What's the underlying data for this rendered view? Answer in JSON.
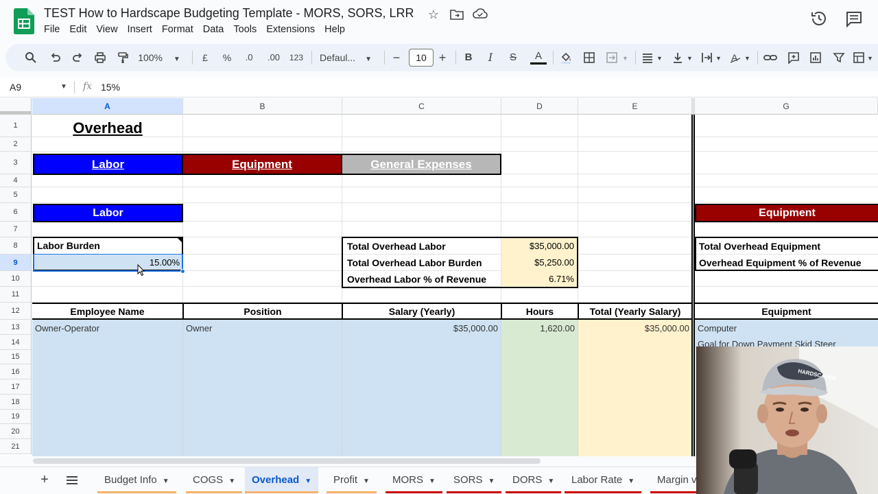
{
  "app": {
    "title": "TEST How to Hardscape Budgeting Template - MORS, SORS, LRR",
    "menu": [
      "File",
      "Edit",
      "View",
      "Insert",
      "Format",
      "Data",
      "Tools",
      "Extensions",
      "Help"
    ]
  },
  "toolbar": {
    "zoom": "100%",
    "currency": "£",
    "percent": "%",
    "dec_less": ".0",
    "dec_more": ".00",
    "format_num": "123",
    "font": "Defaul...",
    "font_size": "10",
    "minus": "−",
    "plus": "+",
    "bold": "B",
    "italic": "I",
    "strike": "S",
    "textcolor": "A"
  },
  "formula_bar": {
    "name_box": "A9",
    "fx": "fx",
    "value": "15%"
  },
  "grid": {
    "columns": [
      "A",
      "B",
      "C",
      "D",
      "E",
      "G"
    ],
    "rows": [
      "1",
      "2",
      "3",
      "4",
      "5",
      "6",
      "7",
      "8",
      "9",
      "10",
      "11",
      "12",
      "13",
      "14",
      "15",
      "16",
      "17",
      "18",
      "19",
      "20",
      "21"
    ],
    "a1": "Overhead",
    "nav_labor": "Labor",
    "nav_equipment": "Equipment",
    "nav_general": "General Expenses",
    "labor_header": "Labor",
    "equipment_header": "Equipment",
    "labor_burden_label": "Labor Burden",
    "labor_burden_value": "15.00%",
    "summary_labels": [
      "Total Overhead Labor",
      "Total Overhead Labor Burden",
      "Overhead Labor % of Revenue"
    ],
    "summary_values": [
      "$35,000.00",
      "$5,250.00",
      "6.71%"
    ],
    "equip_summary_labels": [
      "Total Overhead Equipment",
      "Overhead Equipment % of Revenue"
    ],
    "table_headers": [
      "Employee Name",
      "Position",
      "Salary (Yearly)",
      "Hours",
      "Total (Yearly Salary)",
      "Equipment"
    ],
    "row13": [
      "Owner-Operator",
      "Owner",
      "$35,000.00",
      "1,620.00",
      "$35,000.00",
      "Computer"
    ],
    "g14": "Goal for Down Payment Skid Steer"
  },
  "tabs": [
    {
      "label": "Budget Info",
      "color": "#f6b26b"
    },
    {
      "label": "COGS",
      "color": "#f6b26b"
    },
    {
      "label": "Overhead",
      "color": "#f6b26b"
    },
    {
      "label": "Profit",
      "color": "#f6b26b"
    },
    {
      "label": "MORS",
      "color": "#cc0000"
    },
    {
      "label": "SORS",
      "color": "#cc0000"
    },
    {
      "label": "DORS",
      "color": "#cc0000"
    },
    {
      "label": "Labor Rate",
      "color": "#cc0000"
    },
    {
      "label": "Margin v",
      "color": "#cc0000"
    }
  ],
  "colors": {
    "labor_blue": "#0000ff",
    "equipment_red": "#990000",
    "general_gray": "#b7b7b7",
    "selection": "#1a73e8",
    "sheets_green": "#0f9d58"
  }
}
